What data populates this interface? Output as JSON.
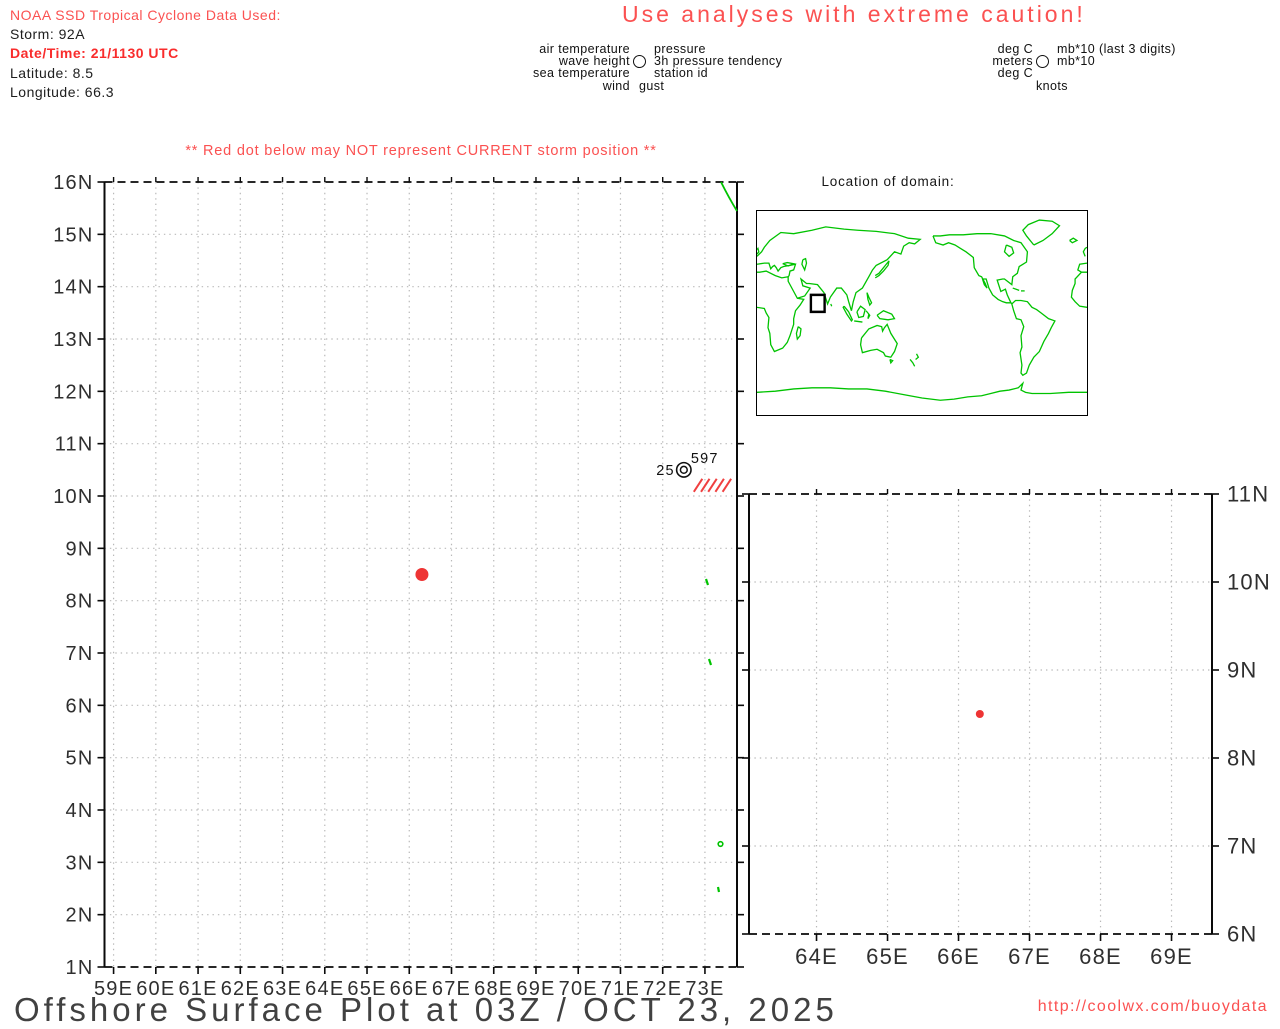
{
  "colors": {
    "salmon_red": "#fb5151",
    "bold_red": "#f92c2c",
    "storm_dot_red": "#ee3434",
    "gust_hatch_red": "#f04040",
    "coastline_green": "#00c300",
    "grid_gray": "#b9b9b9",
    "axis_text": "#2f2f2f"
  },
  "header": {
    "storm_info": {
      "line1": "NOAA SSD Tropical Cyclone Data Used:",
      "line2": "Storm: 92A",
      "line3": "Date/Time: 21/1130 UTC",
      "line4": "Latitude: 8.5",
      "line5": "Longitude: 66.3"
    },
    "caution": "Use analyses with extreme caution!",
    "station_legend": {
      "rows": [
        [
          "air temperature",
          "pressure"
        ],
        [
          "wave height",
          "3h pressure tendency"
        ],
        [
          "sea temperature",
          "station id"
        ],
        [
          "wind",
          "gust"
        ]
      ]
    },
    "units_legend": {
      "rows": [
        [
          "deg C",
          "mb*10 (last 3 digits)"
        ],
        [
          "meters",
          "mb*10"
        ],
        [
          "deg C",
          ""
        ],
        [
          "",
          "knots"
        ]
      ]
    }
  },
  "main_plot_warning": "** Red dot below may NOT represent CURRENT storm position **",
  "inset_map_title": "Location of domain:",
  "footer": {
    "title": "Offshore Surface Plot at 03Z / OCT 23, 2025",
    "url": "http://coolwx.com/buoydata"
  },
  "chart_data": [
    {
      "type": "scatter",
      "name": "main-offshore-surface-plot",
      "title": "Offshore surface observations map, Arabian Sea",
      "x_tick_labels": [
        "59E",
        "60E",
        "61E",
        "62E",
        "63E",
        "64E",
        "65E",
        "66E",
        "67E",
        "68E",
        "69E",
        "70E",
        "71E",
        "72E",
        "73E"
      ],
      "y_tick_labels": [
        "1N",
        "2N",
        "3N",
        "4N",
        "5N",
        "6N",
        "7N",
        "8N",
        "9N",
        "10N",
        "11N",
        "12N",
        "13N",
        "14N",
        "15N",
        "16N"
      ],
      "xlim": [
        58.785,
        73.759
      ],
      "ylim": [
        1,
        16
      ],
      "grid": "dotted",
      "x_label_side": "bottom",
      "y_label_side": "left",
      "points": [
        {
          "x": 66.3,
          "y": 8.5,
          "label": "storm 92A position (red dot)",
          "color": "#ee3434",
          "radius": 6.5
        }
      ],
      "station_report": {
        "x": 72.5,
        "y": 10.5,
        "symbol": "double-circle",
        "left_text": "25",
        "upper_right_text": "597",
        "gust_hatch_count": 5,
        "gust_hatch_color": "#f04040"
      },
      "coastline_notes": "green fragments: SW India coast at top-right corner, Lakshadweep/Maldives island specks along 73E"
    },
    {
      "type": "scatter",
      "name": "zoomed-offshore-surface-plot",
      "title": "Zoomed domain around storm",
      "x_tick_labels": [
        "64E",
        "65E",
        "66E",
        "67E",
        "68E",
        "69E"
      ],
      "y_tick_labels": [
        "6N",
        "7N",
        "8N",
        "9N",
        "10N",
        "11N"
      ],
      "xlim": [
        63.049,
        69.57
      ],
      "ylim": [
        6,
        11
      ],
      "grid": "dotted",
      "x_label_side": "bottom",
      "y_label_side": "right",
      "points": [
        {
          "x": 66.3,
          "y": 8.5,
          "label": "storm 92A position (red dot)",
          "color": "#ee3434",
          "radius": 4
        }
      ]
    }
  ]
}
